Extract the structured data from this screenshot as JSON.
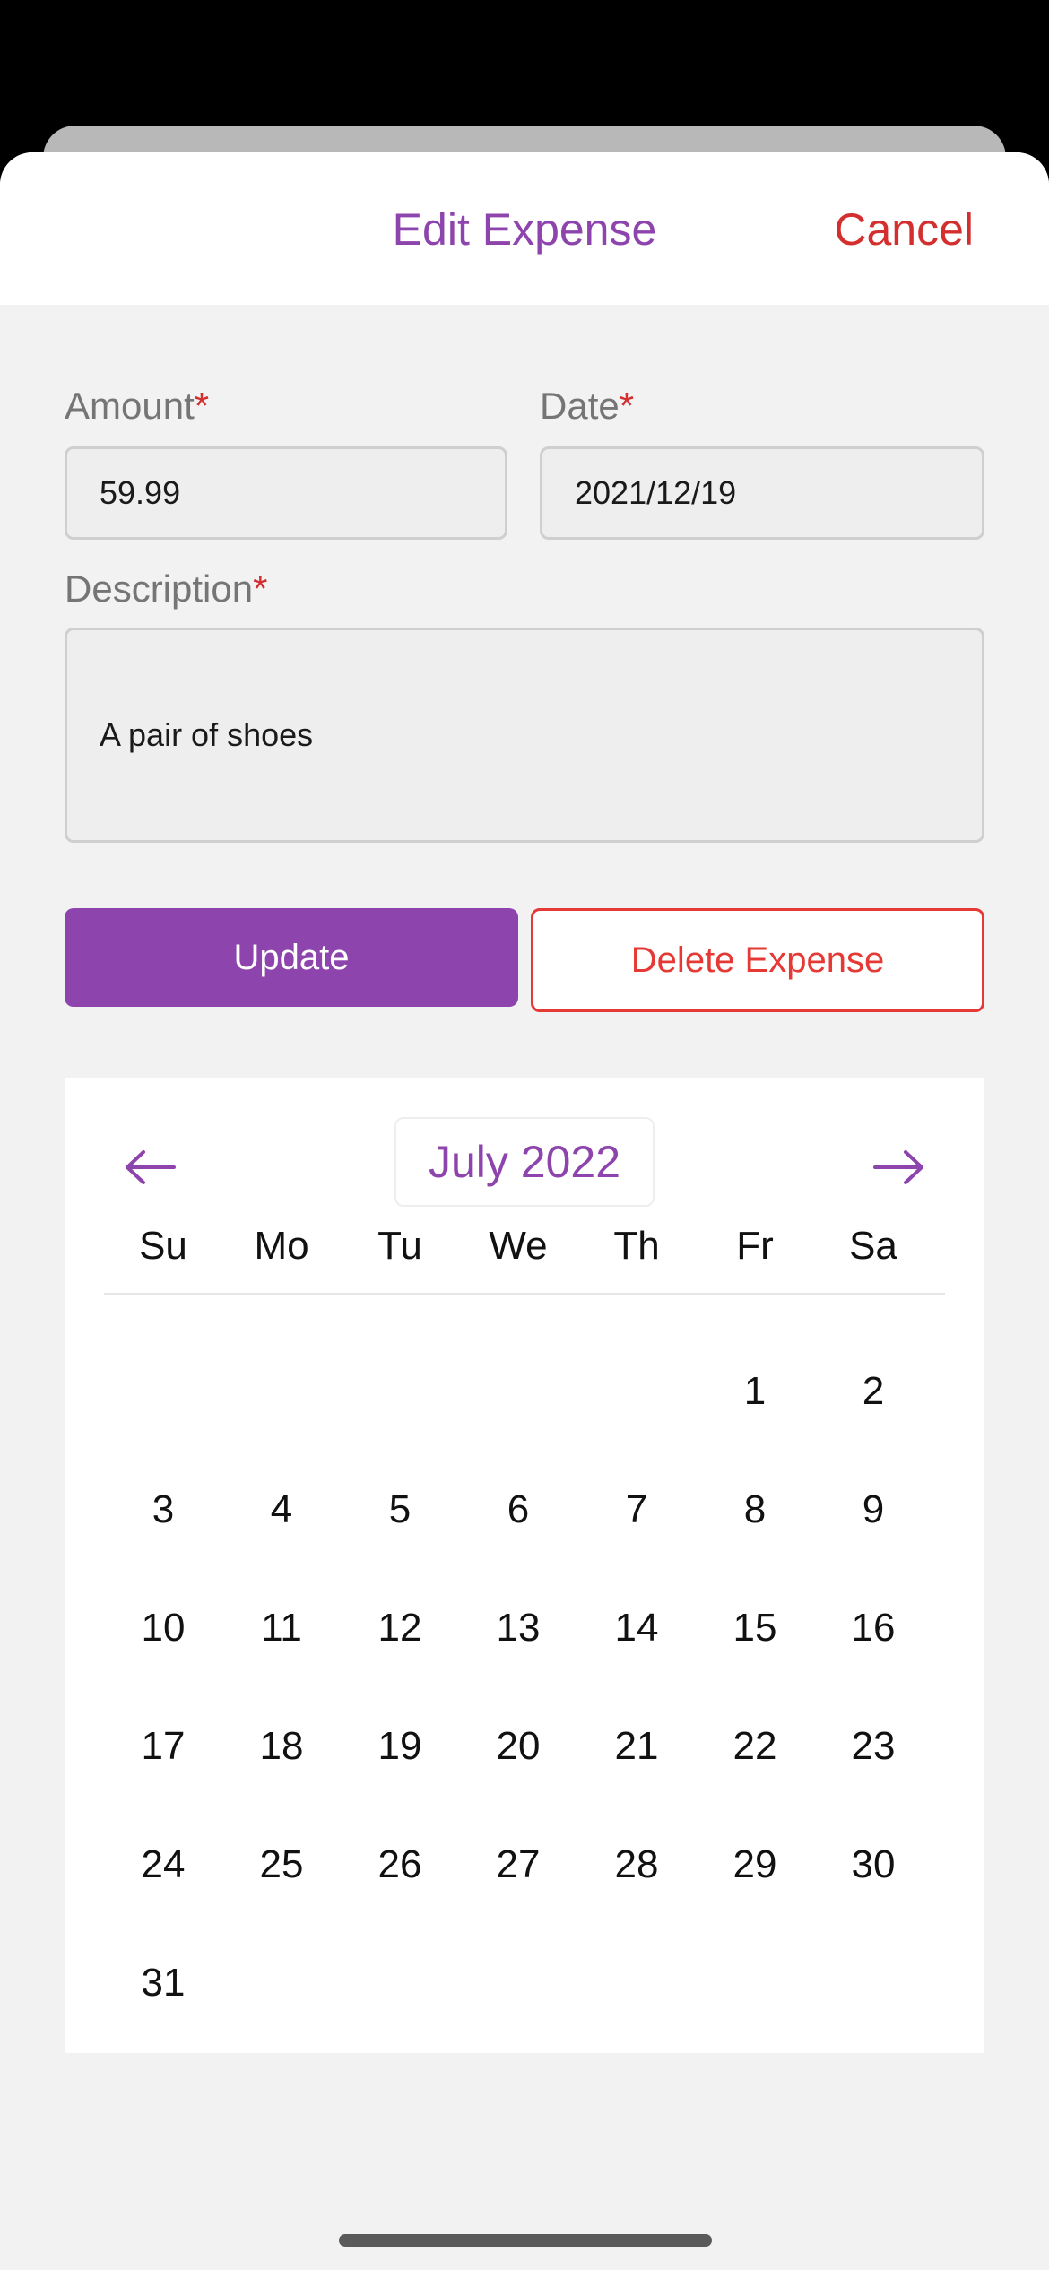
{
  "header": {
    "title": "Edit Expense",
    "cancel_label": "Cancel"
  },
  "form": {
    "amount": {
      "label": "Amount",
      "required_mark": "*",
      "value": "59.99"
    },
    "date": {
      "label": "Date",
      "required_mark": "*",
      "value": "2021/12/19"
    },
    "description": {
      "label": "Description",
      "required_mark": "*",
      "value": "A pair of shoes"
    }
  },
  "actions": {
    "update_label": "Update",
    "delete_label": "Delete Expense"
  },
  "calendar": {
    "month_label": "July 2022",
    "prev_icon": "arrow-left-icon",
    "next_icon": "arrow-right-icon",
    "weekdays": [
      "Su",
      "Mo",
      "Tu",
      "We",
      "Th",
      "Fr",
      "Sa"
    ],
    "first_weekday_index": 5,
    "days": [
      "1",
      "2",
      "3",
      "4",
      "5",
      "6",
      "7",
      "8",
      "9",
      "10",
      "11",
      "12",
      "13",
      "14",
      "15",
      "16",
      "17",
      "18",
      "19",
      "20",
      "21",
      "22",
      "23",
      "24",
      "25",
      "26",
      "27",
      "28",
      "29",
      "30",
      "31"
    ]
  },
  "colors": {
    "accent": "#8e44ad",
    "danger": "#d32f2f",
    "delete": "#e53935"
  }
}
